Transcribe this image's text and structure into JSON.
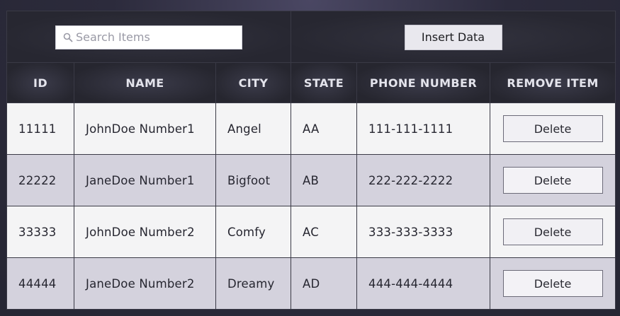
{
  "toolbar": {
    "search_placeholder": "Search Items",
    "search_value": "",
    "insert_label": "Insert Data"
  },
  "columns": [
    "ID",
    "NAME",
    "CITY",
    "STATE",
    "PHONE NUMBER",
    "REMOVE ITEM"
  ],
  "rows": [
    {
      "id": "11111",
      "name": "JohnDoe Number1",
      "city": "Angel",
      "state": "AA",
      "phone": "111-111-1111",
      "action": "Delete"
    },
    {
      "id": "22222",
      "name": "JaneDoe Number1",
      "city": "Bigfoot",
      "state": "AB",
      "phone": "222-222-2222",
      "action": "Delete"
    },
    {
      "id": "33333",
      "name": "JohnDoe Number2",
      "city": "Comfy",
      "state": "AC",
      "phone": "333-333-3333",
      "action": "Delete"
    },
    {
      "id": "44444",
      "name": "JaneDoe Number2",
      "city": "Dreamy",
      "state": "AD",
      "phone": "444-444-4444",
      "action": "Delete"
    }
  ],
  "icons": {
    "search": "search-icon"
  },
  "colors": {
    "background": "#2c2b3c",
    "header_bg": "#27272f",
    "row_odd": "#f4f4f5",
    "row_even": "#d4d2dd",
    "header_text": "#e4e4ec"
  }
}
